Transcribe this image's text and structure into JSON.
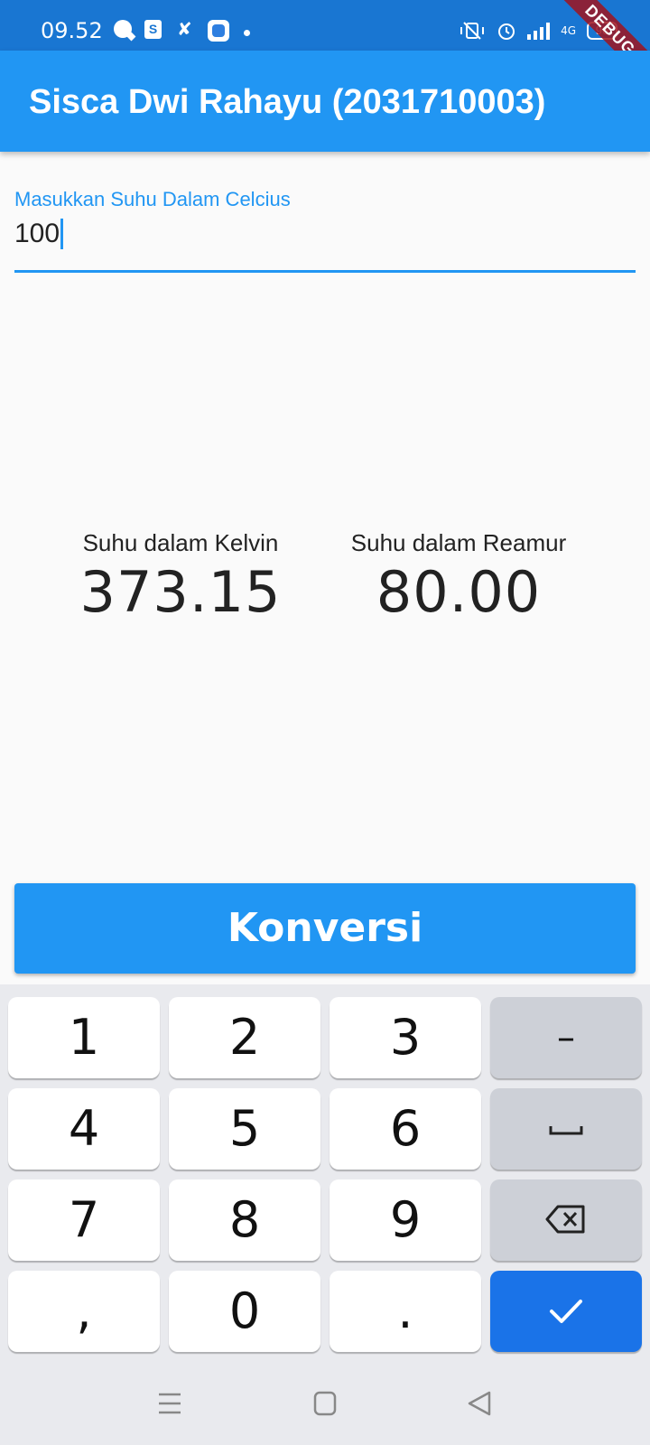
{
  "status_bar": {
    "time": "09.52",
    "icons": [
      "chat-bubble-icon",
      "shopping-bag-icon",
      "bow-icon",
      "app-icon",
      "dot-icon",
      "vibrate-icon",
      "alarm-icon",
      "signal-icon",
      "4g-signal-icon",
      "battery-icon"
    ],
    "network_label": "4G",
    "battery_level": "96",
    "bag_letter": "S"
  },
  "debug_banner": "DEBUG",
  "app_bar": {
    "title": "Sisca Dwi Rahayu (2031710003)"
  },
  "input": {
    "label": "Masukkan Suhu Dalam Celcius",
    "value": "100",
    "accent_color": "#2196f3"
  },
  "results": {
    "kelvin": {
      "label": "Suhu dalam Kelvin",
      "value": "373.15"
    },
    "reamur": {
      "label": "Suhu dalam Reamur",
      "value": "80.00"
    }
  },
  "convert_button": {
    "label": "Konversi"
  },
  "keyboard": {
    "keys": {
      "k1": "1",
      "k2": "2",
      "k3": "3",
      "dash": "–",
      "k4": "4",
      "k5": "5",
      "k6": "6",
      "k7": "7",
      "k8": "8",
      "k9": "9",
      "comma": ",",
      "k0": "0",
      "period": "."
    },
    "special_keys": [
      "space-key",
      "backspace-key",
      "done-key"
    ]
  },
  "nav_bar": {
    "buttons": [
      "menu-icon",
      "home-icon",
      "back-icon"
    ]
  },
  "colors": {
    "status_bar": "#1976d2",
    "app_bar": "#2196f3",
    "button": "#2196f3",
    "done_key": "#1a73e8",
    "background": "#fafafa"
  }
}
